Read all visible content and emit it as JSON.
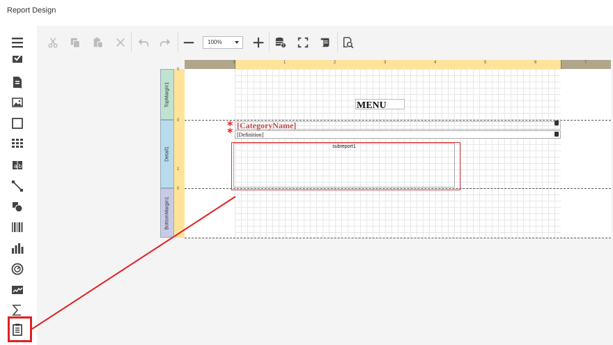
{
  "window": {
    "title": "Report Design"
  },
  "toolbar": {
    "items": [
      {
        "name": "cut-icon",
        "enabled": false
      },
      {
        "name": "copy-icon",
        "enabled": false
      },
      {
        "name": "paste-icon",
        "enabled": false
      },
      {
        "name": "delete-icon",
        "enabled": false
      },
      {
        "name": "undo-icon",
        "enabled": false
      },
      {
        "name": "redo-icon",
        "enabled": false
      },
      {
        "name": "zoom-out-icon",
        "enabled": true
      },
      {
        "name": "zoom-in-icon",
        "enabled": true
      },
      {
        "name": "validate-bindings-icon",
        "enabled": true
      },
      {
        "name": "full-screen-icon",
        "enabled": true
      },
      {
        "name": "scripts-icon",
        "enabled": true
      },
      {
        "name": "preview-icon",
        "enabled": true
      }
    ],
    "zoom_value": "100%"
  },
  "toolbox": {
    "menu_icon": "hamburger-icon",
    "items": [
      "checkbox-icon",
      "rich-text-icon",
      "picture-box-icon",
      "panel-icon",
      "table-icon",
      "character-comb-icon",
      "line-icon",
      "shape-icon",
      "barcode-icon",
      "chart-icon",
      "gauge-icon",
      "sparkline-icon",
      "summary-icon",
      "subreport-icon"
    ],
    "selected": "subreport-icon"
  },
  "ruler": {
    "labels": [
      "0",
      "1",
      "2",
      "3",
      "4",
      "5",
      "6",
      "7"
    ]
  },
  "vertical_ruler": {
    "labels": [
      "0",
      "0",
      "1",
      "0"
    ]
  },
  "bands": [
    {
      "name": "TopMargin1"
    },
    {
      "name": "Detail1"
    },
    {
      "name": "BottomMargin1"
    }
  ],
  "controls": {
    "title_label": "MENU",
    "category_name": "[CategoryName]",
    "definition": "[Definition]",
    "subreport_label": "subreport1"
  },
  "colors": {
    "accent_red": "#e02020",
    "field_red": "#c0504d",
    "ruler": "#ffe399",
    "band": "#add8e6"
  }
}
